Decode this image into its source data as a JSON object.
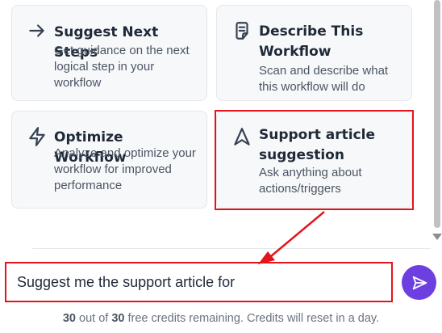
{
  "cards": [
    {
      "icon": "arrow-right-icon",
      "title": "Suggest Next Steps",
      "description": "Get guidance on the next logical step in your workflow"
    },
    {
      "icon": "clipboard-list-icon",
      "title": "Describe This Workflow",
      "description": "Scan and describe what this workflow will do"
    },
    {
      "icon": "lightning-bolt-icon",
      "title": "Optimize Workflow",
      "description": "Analyze and optimize your workflow for improved performance"
    },
    {
      "icon": "navigation-arrow-icon",
      "title": "Support article suggestion",
      "description": "Ask anything about actions/triggers"
    }
  ],
  "input": {
    "value": "Suggest me the support article for"
  },
  "credits": {
    "remaining": "30",
    "out_of_text": "out of",
    "total": "30",
    "suffix": "free credits remaining. Credits will reset in a day."
  },
  "colors": {
    "send_button": "#6d3fe0",
    "highlight": "#e3141b",
    "card_bg": "#f7f8fa"
  }
}
